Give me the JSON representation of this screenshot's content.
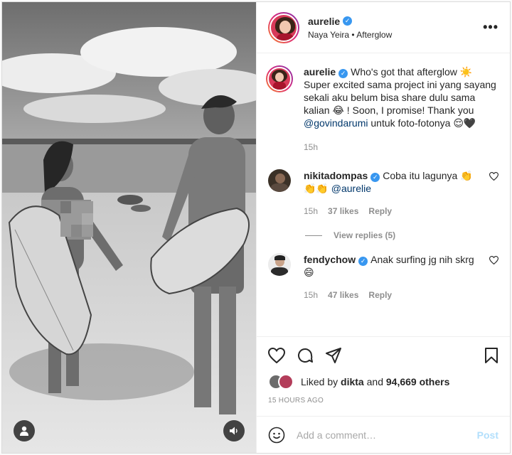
{
  "post": {
    "username": "aurelie",
    "subtitle": "Naya Yeira • Afterglow",
    "more_label": "•••"
  },
  "caption": {
    "username": "aurelie",
    "text_part1": "Who's got that afterglow ☀️ Super excited sama project ini yang sayang sekali aku belum bisa share dulu sama kalian 😂 ! Soon, I promise! Thank you ",
    "mention": "@govindarumi",
    "text_part2": " untuk foto-fotonya 😌🖤",
    "time": "15h"
  },
  "comments": [
    {
      "username": "nikitadompas",
      "text": "Coba itu lagunya 👏👏👏 ",
      "mention": "@aurelie",
      "time": "15h",
      "likes": "37 likes",
      "reply_label": "Reply"
    },
    {
      "username": "fendychow",
      "text": "Anak surfing jg nih skrg 😄",
      "time": "15h",
      "likes": "47 likes",
      "reply_label": "Reply"
    }
  ],
  "view_replies_label": "View replies (5)",
  "likes_line": {
    "prefix": "Liked by ",
    "user": "dikta",
    "middle": " and ",
    "count": "94,669 others"
  },
  "timestamp": "15 HOURS AGO",
  "add_comment": {
    "placeholder": "Add a comment…",
    "post_label": "Post"
  },
  "colors": {
    "verified": "#3897f0",
    "mention": "#00376b",
    "post_disabled": "#b2dffc",
    "muted": "#8e8e8e"
  }
}
